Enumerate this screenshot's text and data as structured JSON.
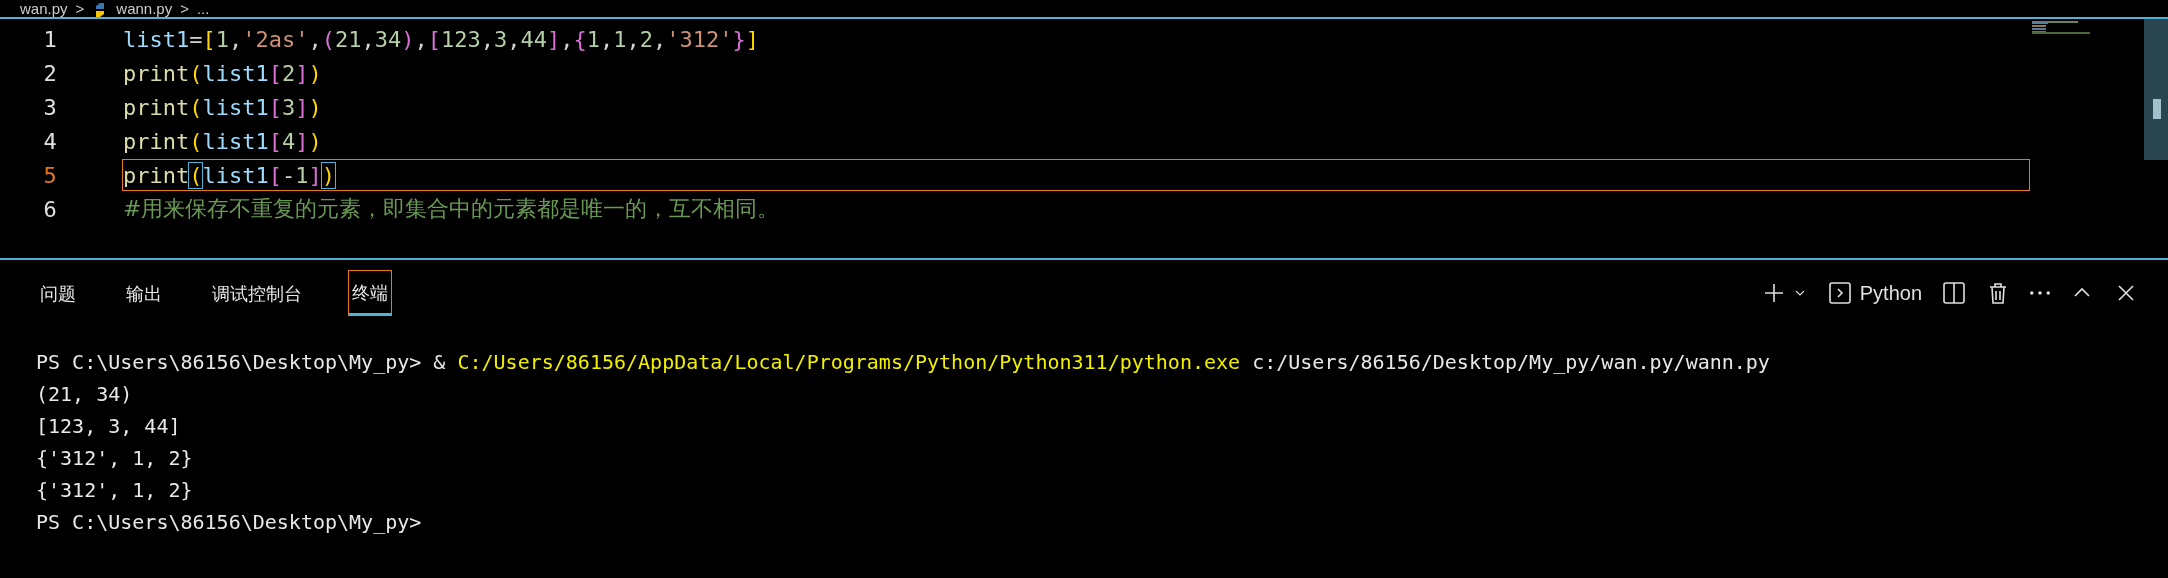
{
  "breadcrumb": [
    {
      "kind": "file",
      "label": "wan.py"
    },
    {
      "kind": "sep",
      "label": ">"
    },
    {
      "kind": "pyfile",
      "label": "wann.py"
    },
    {
      "kind": "sep",
      "label": ">"
    },
    {
      "kind": "file",
      "label": "..."
    }
  ],
  "editor": {
    "lines": [
      {
        "number": "1",
        "current": false,
        "tokens": [
          {
            "kind": "var",
            "text": "list1"
          },
          {
            "kind": "op",
            "text": "="
          },
          {
            "kind": "b1",
            "text": "["
          },
          {
            "kind": "num",
            "text": "1"
          },
          {
            "kind": "op",
            "text": ","
          },
          {
            "kind": "str",
            "text": "'2as'"
          },
          {
            "kind": "op",
            "text": ","
          },
          {
            "kind": "b2",
            "text": "("
          },
          {
            "kind": "num",
            "text": "21"
          },
          {
            "kind": "op",
            "text": ","
          },
          {
            "kind": "num",
            "text": "34"
          },
          {
            "kind": "b2",
            "text": ")"
          },
          {
            "kind": "op",
            "text": ","
          },
          {
            "kind": "b2",
            "text": "["
          },
          {
            "kind": "num",
            "text": "123"
          },
          {
            "kind": "op",
            "text": ","
          },
          {
            "kind": "num",
            "text": "3"
          },
          {
            "kind": "op",
            "text": ","
          },
          {
            "kind": "num",
            "text": "44"
          },
          {
            "kind": "b2",
            "text": "]"
          },
          {
            "kind": "op",
            "text": ","
          },
          {
            "kind": "b2",
            "text": "{"
          },
          {
            "kind": "num",
            "text": "1"
          },
          {
            "kind": "op",
            "text": ","
          },
          {
            "kind": "num",
            "text": "1"
          },
          {
            "kind": "op",
            "text": ","
          },
          {
            "kind": "num",
            "text": "2"
          },
          {
            "kind": "op",
            "text": ","
          },
          {
            "kind": "str",
            "text": "'312'"
          },
          {
            "kind": "b2",
            "text": "}"
          },
          {
            "kind": "b1",
            "text": "]"
          }
        ]
      },
      {
        "number": "2",
        "current": false,
        "tokens": [
          {
            "kind": "fn",
            "text": "print"
          },
          {
            "kind": "b1",
            "text": "("
          },
          {
            "kind": "var",
            "text": "list1"
          },
          {
            "kind": "b2",
            "text": "["
          },
          {
            "kind": "num",
            "text": "2"
          },
          {
            "kind": "b2",
            "text": "]"
          },
          {
            "kind": "b1",
            "text": ")"
          }
        ]
      },
      {
        "number": "3",
        "current": false,
        "tokens": [
          {
            "kind": "fn",
            "text": "print"
          },
          {
            "kind": "b1",
            "text": "("
          },
          {
            "kind": "var",
            "text": "list1"
          },
          {
            "kind": "b2",
            "text": "["
          },
          {
            "kind": "num",
            "text": "3"
          },
          {
            "kind": "b2",
            "text": "]"
          },
          {
            "kind": "b1",
            "text": ")"
          }
        ]
      },
      {
        "number": "4",
        "current": false,
        "tokens": [
          {
            "kind": "fn",
            "text": "print"
          },
          {
            "kind": "b1",
            "text": "("
          },
          {
            "kind": "var",
            "text": "list1"
          },
          {
            "kind": "b2",
            "text": "["
          },
          {
            "kind": "num",
            "text": "4"
          },
          {
            "kind": "b2",
            "text": "]"
          },
          {
            "kind": "b1",
            "text": ")"
          }
        ]
      },
      {
        "number": "5",
        "current": true,
        "tokens": [
          {
            "kind": "fn",
            "text": "print"
          },
          {
            "kind": "b1",
            "text": "(",
            "matched": true
          },
          {
            "kind": "var",
            "text": "list1"
          },
          {
            "kind": "b2",
            "text": "["
          },
          {
            "kind": "op",
            "text": "-"
          },
          {
            "kind": "num",
            "text": "1"
          },
          {
            "kind": "b2",
            "text": "]"
          },
          {
            "kind": "b1",
            "text": ")",
            "matched": true
          }
        ]
      },
      {
        "number": "6",
        "current": false,
        "tokens": [
          {
            "kind": "comment",
            "text": "#用来保存不重复的元素，即集合中的元素都是唯一的，互不相同。"
          }
        ]
      }
    ]
  },
  "panel": {
    "tabs": [
      {
        "label": "问题",
        "selected": false
      },
      {
        "label": "输出",
        "selected": false
      },
      {
        "label": "调试控制台",
        "selected": false
      },
      {
        "label": "终端",
        "selected": true
      }
    ],
    "terminal_name": "Python",
    "terminal": [
      [
        {
          "kind": "plain",
          "text": "PS C:\\Users\\86156\\Desktop\\My_py> & "
        },
        {
          "kind": "path",
          "text": "C:/Users/86156/AppData/Local/Programs/Python/Python311/python.exe"
        },
        {
          "kind": "plain",
          "text": " c:/Users/86156/Desktop/My_py/wan.py/wann.py"
        }
      ],
      [
        {
          "kind": "plain",
          "text": "(21, 34)"
        }
      ],
      [
        {
          "kind": "plain",
          "text": "[123, 3, 44]"
        }
      ],
      [
        {
          "kind": "plain",
          "text": "{'312', 1, 2}"
        }
      ],
      [
        {
          "kind": "plain",
          "text": "{'312', 1, 2}"
        }
      ],
      [
        {
          "kind": "plain",
          "text": "PS C:\\Users\\86156\\Desktop\\My_py>"
        }
      ]
    ]
  }
}
